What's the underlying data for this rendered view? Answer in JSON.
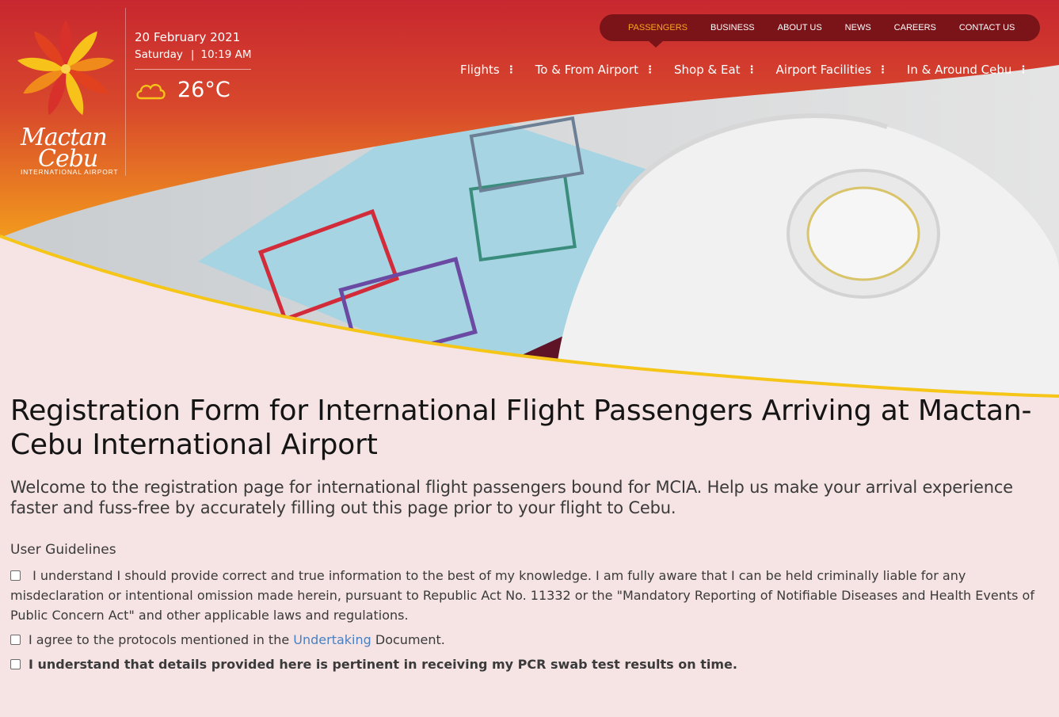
{
  "header": {
    "logo": {
      "script_line1": "Mactan",
      "script_line2": "Cebu",
      "subtitle": "INTERNATIONAL AIRPORT"
    },
    "date": "20 February 2021",
    "day": "Saturday",
    "separator": "|",
    "time": "10:19 AM",
    "temperature": "26°C",
    "weather_icon": "cloud-icon"
  },
  "topnav": {
    "items": [
      {
        "label": "PASSENGERS",
        "active": true
      },
      {
        "label": "BUSINESS"
      },
      {
        "label": "ABOUT US"
      },
      {
        "label": "NEWS"
      },
      {
        "label": "CAREERS"
      },
      {
        "label": "CONTACT US"
      }
    ]
  },
  "mainnav": {
    "items": [
      {
        "label": "Flights"
      },
      {
        "label": "To & From Airport"
      },
      {
        "label": "Shop & Eat"
      },
      {
        "label": "Airport Facilities"
      },
      {
        "label": "In & Around Cebu"
      }
    ],
    "dots": "⋮"
  },
  "main": {
    "title": "Registration Form for International Flight Passengers Arriving at Mactan-Cebu International Airport",
    "intro": "Welcome to the registration page for international flight passengers bound for MCIA. Help us make your arrival experience faster and fuss-free by accurately filling out this page prior to your flight to Cebu.",
    "guidelines_heading": "User Guidelines",
    "check1": "I understand I should provide correct and true information to the best of my knowledge. I am fully aware that I can be held criminally liable for any misdeclaration or intentional omission made herein, pursuant to Republic Act No. 11332 or the \"Mandatory Reporting of Notifiable Diseases and Health Events of Public Concern Act\" and other applicable laws and regulations.",
    "check2_prefix": "I agree to the protocols mentioned in the",
    "check2_link": "Undertaking",
    "check2_suffix": "Document.",
    "check3": "I understand that details provided here is pertinent in receiving my PCR swab test results on time."
  },
  "colors": {
    "header_red": "#cc3033",
    "header_orange": "#ee8a1a",
    "pill_nav": "#7a1419",
    "active_nav": "#f6a623",
    "curve_gold": "#f5c518",
    "page_bg": "#f6e4e5",
    "link": "#4a7fc1"
  }
}
